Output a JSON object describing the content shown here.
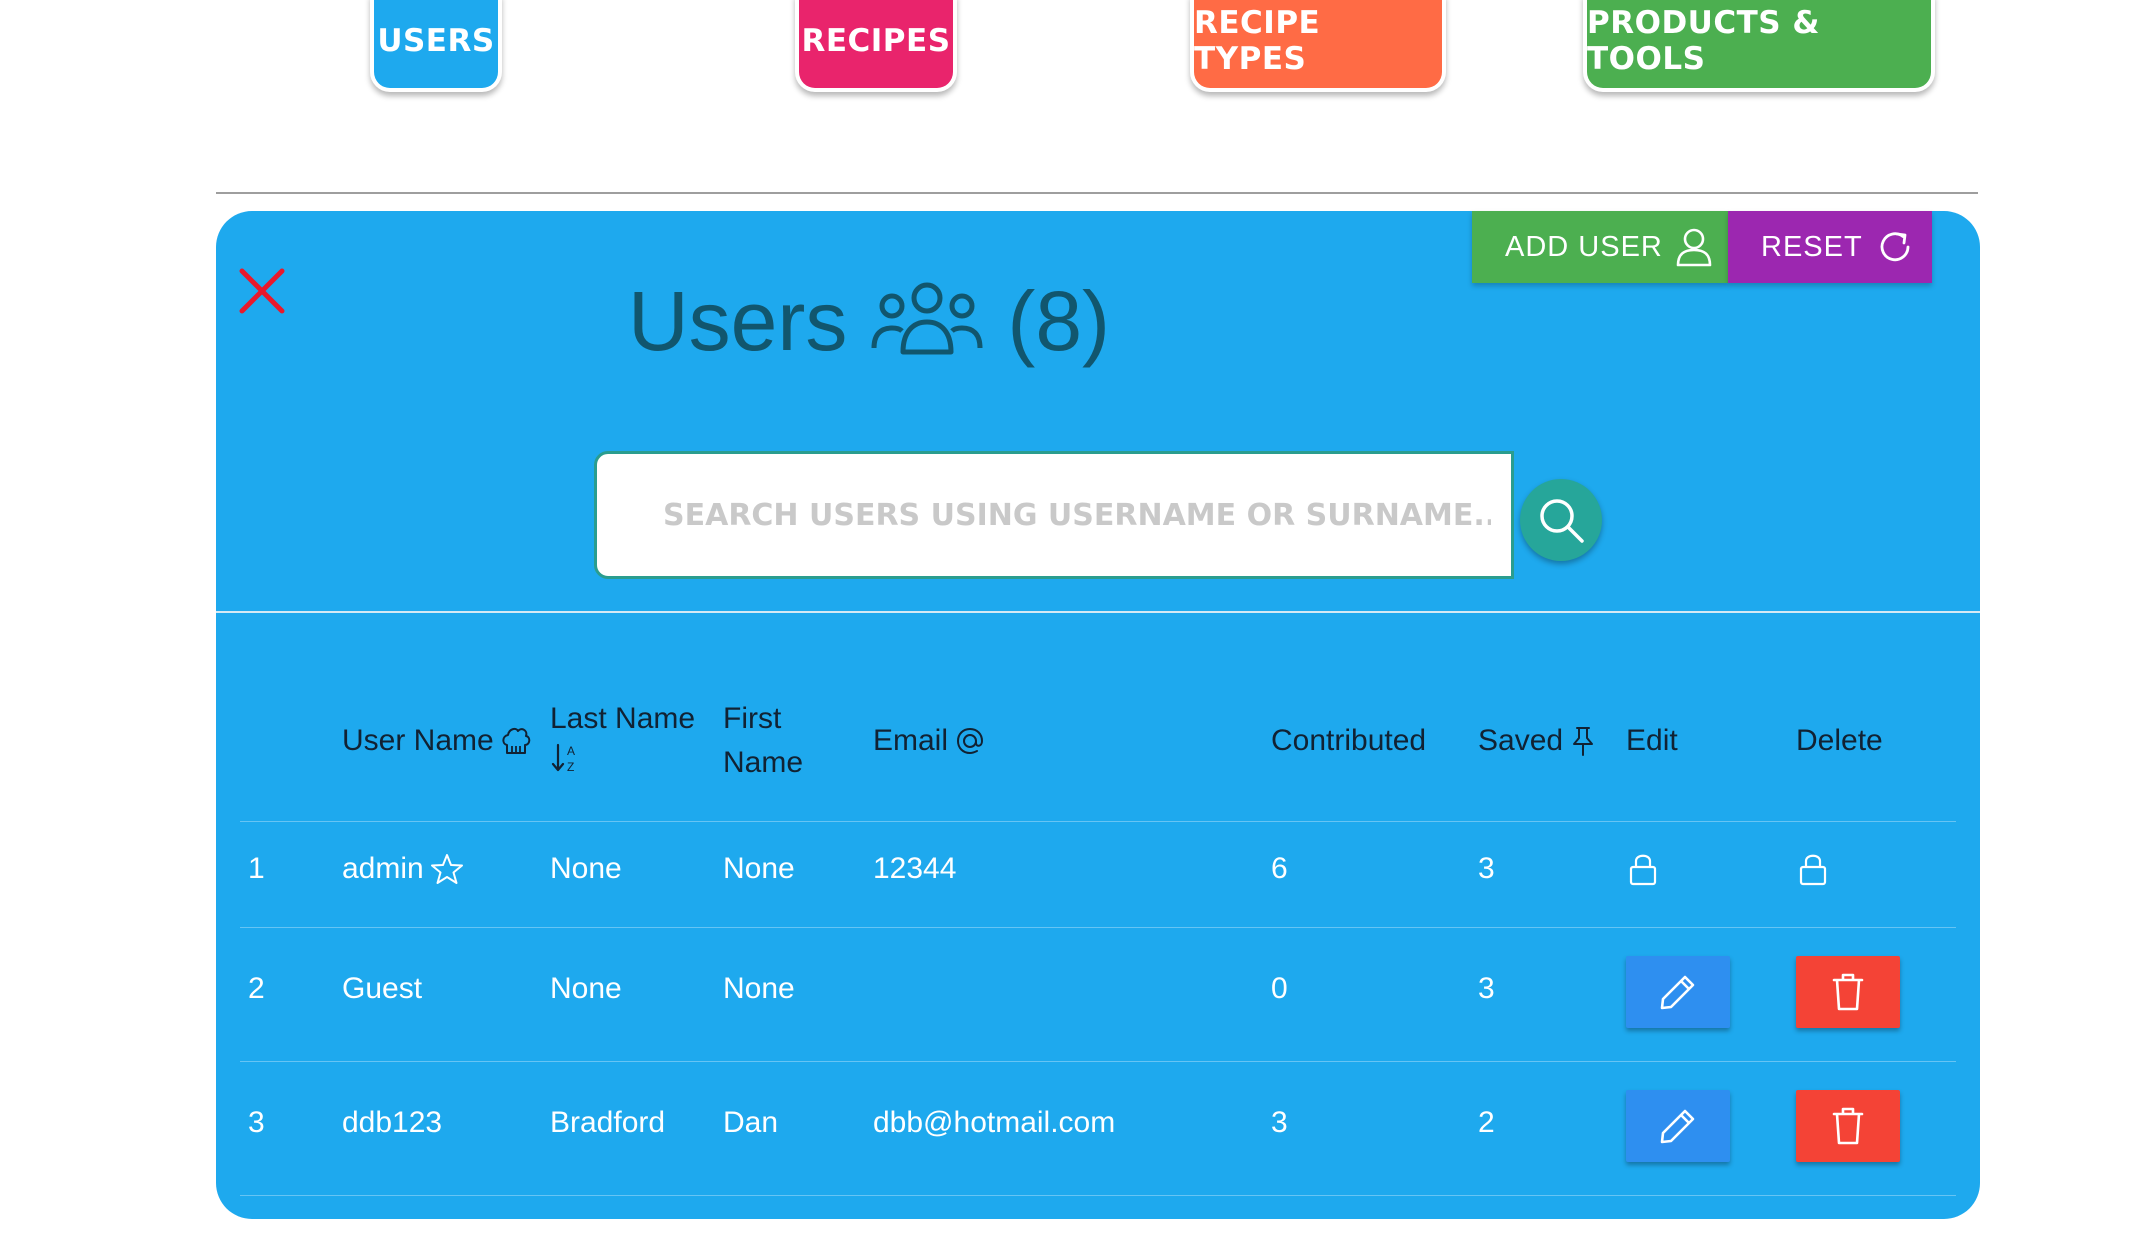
{
  "nav": {
    "tabs": [
      {
        "label": "USERS",
        "color": "#1ea9ee"
      },
      {
        "label": "RECIPES",
        "color": "#e9246c"
      },
      {
        "label": "RECIPE TYPES",
        "color": "#ff6b45"
      },
      {
        "label": "PRODUCTS & TOOLS",
        "color": "#4caf50"
      }
    ]
  },
  "panel": {
    "title": "Users",
    "count": "(8)",
    "add_button": "ADD USER",
    "reset_button": "RESET",
    "search": {
      "placeholder": "SEARCH USERS USING USERNAME OR SURNAME..."
    }
  },
  "table": {
    "headers": {
      "username": "User Name",
      "lastname": "Last Name",
      "firstname_line1": "First",
      "firstname_line2": "Name",
      "email": "Email",
      "contributed": "Contributed",
      "saved": "Saved",
      "edit": "Edit",
      "delete": "Delete"
    },
    "rows": [
      {
        "index": "1",
        "username": "admin",
        "lastname": "None",
        "firstname": "None",
        "email": "12344",
        "contributed": "6",
        "saved": "3",
        "locked": true
      },
      {
        "index": "2",
        "username": "Guest",
        "lastname": "None",
        "firstname": "None",
        "email": "",
        "contributed": "0",
        "saved": "3",
        "locked": false
      },
      {
        "index": "3",
        "username": "ddb123",
        "lastname": "Bradford",
        "firstname": "Dan",
        "email": "dbb@hotmail.com",
        "contributed": "3",
        "saved": "2",
        "locked": false
      }
    ]
  },
  "colors": {
    "panel": "#1ea9ee",
    "title": "#11566e",
    "add": "#4caf50",
    "reset": "#9c27b0",
    "edit": "#2e8ff0",
    "delete": "#f44336",
    "close": "#e8192c"
  },
  "icons": [
    "close-icon",
    "user-icon",
    "refresh-icon",
    "users-group-icon",
    "search-icon",
    "chef-hat-icon",
    "sort-alpha-icon",
    "at-icon",
    "pin-icon",
    "star-icon",
    "lock-icon",
    "pencil-icon",
    "trash-icon"
  ]
}
